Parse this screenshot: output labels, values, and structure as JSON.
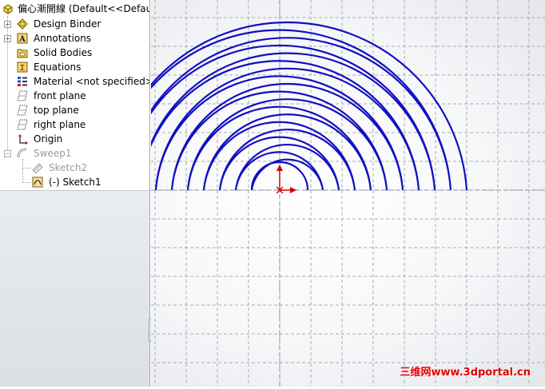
{
  "tree": {
    "part_name": "偏心漸開線  (Default<<Defau",
    "items": [
      {
        "label": "Design Binder"
      },
      {
        "label": "Annotations"
      },
      {
        "label": "Solid Bodies"
      },
      {
        "label": "Equations"
      },
      {
        "label": "Material <not specified>"
      },
      {
        "label": "front plane"
      },
      {
        "label": "top plane"
      },
      {
        "label": "right plane"
      },
      {
        "label": "Origin"
      },
      {
        "label": "Sweep1"
      },
      {
        "label": "Sketch2"
      },
      {
        "label": "(-) Sketch1"
      }
    ]
  },
  "icons": {
    "part": "part-icon",
    "design_binder": "design-binder-icon",
    "annotations": "annotations-icon",
    "solid_bodies": "solid-bodies-icon",
    "equations": "equations-icon",
    "material": "material-icon",
    "plane": "plane-icon",
    "origin": "origin-icon",
    "sweep": "sweep-icon",
    "sketch": "sketch-icon"
  },
  "colors": {
    "spiral": "#1010c0",
    "axis_arrow": "#cc0000",
    "watermark": "#e60000"
  },
  "watermark": "三维网www.3dportal.cn"
}
